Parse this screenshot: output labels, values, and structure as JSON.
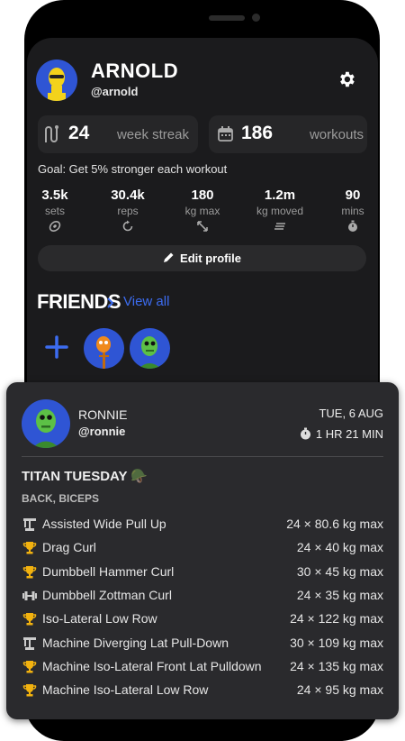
{
  "profile": {
    "name": "ARNOLD",
    "handle": "@arnold"
  },
  "streak": {
    "value": "24",
    "label": "week streak"
  },
  "workouts": {
    "value": "186",
    "label": "workouts"
  },
  "goal": "Goal: Get 5% stronger each workout",
  "metrics": [
    {
      "value": "3.5k",
      "label": "sets",
      "icon": "weight-plate-icon"
    },
    {
      "value": "30.4k",
      "label": "reps",
      "icon": "repeat-icon"
    },
    {
      "value": "180",
      "label": "kg max",
      "icon": "expand-arrows-icon"
    },
    {
      "value": "1.2m",
      "label": "kg moved",
      "icon": "lines-icon"
    },
    {
      "value": "90",
      "label": "mins",
      "icon": "stopwatch-icon"
    }
  ],
  "edit_profile": "Edit profile",
  "friends": {
    "title": "FRIENDS",
    "view_all": "View all"
  },
  "post": {
    "name": "RONNIE",
    "handle": "@ronnie",
    "date": "TUE, 6 AUG",
    "duration": "1 HR 21 MIN",
    "title": "TITAN TUESDAY 🪖",
    "subtitle": "BACK, BICEPS",
    "exercises": [
      {
        "name": "Assisted Wide Pull Up",
        "value": "24 × 80.6 kg max",
        "icon": "machine-icon"
      },
      {
        "name": "Drag Curl",
        "value": "24 × 40 kg max",
        "icon": "trophy-icon"
      },
      {
        "name": "Dumbbell Hammer Curl",
        "value": "30 × 45 kg max",
        "icon": "trophy-icon"
      },
      {
        "name": "Dumbbell Zottman Curl",
        "value": "24 × 35 kg max",
        "icon": "dumbbell-icon"
      },
      {
        "name": "Iso-Lateral Low Row",
        "value": "24 × 122 kg max",
        "icon": "trophy-icon"
      },
      {
        "name": "Machine Diverging Lat Pull-Down",
        "value": "30 × 109 kg max",
        "icon": "machine-icon"
      },
      {
        "name": "Machine Iso-Lateral Front Lat Pulldown",
        "value": "24 × 135 kg max",
        "icon": "trophy-icon"
      },
      {
        "name": "Machine Iso-Lateral Low Row",
        "value": "24 × 95 kg max",
        "icon": "trophy-icon"
      }
    ]
  },
  "colors": {
    "accent": "#3c6cf0",
    "trophy": "#f2b20f",
    "avatar_bg": "#2f55d4"
  }
}
